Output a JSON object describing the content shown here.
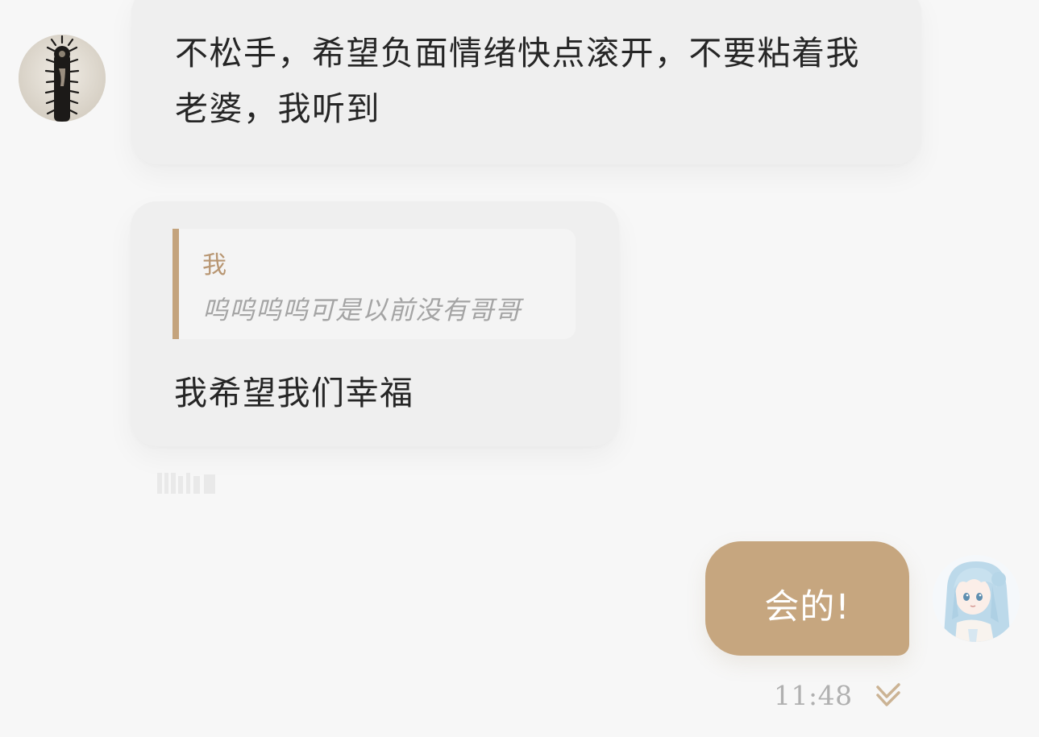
{
  "messages": [
    {
      "direction": "incoming",
      "text": "不松手，希望负面情绪快点滚开，不要粘着我老婆，我听到"
    },
    {
      "direction": "incoming",
      "reply_to": {
        "author": "我",
        "text": "呜呜呜呜可是以前没有哥哥"
      },
      "text": "我希望我们幸福"
    },
    {
      "direction": "outgoing",
      "text": "会的!",
      "time": "11:48",
      "status_icon": "double-check-icon"
    }
  ],
  "colors": {
    "background": "#f7f7f7",
    "incoming_bubble": "#efefef",
    "outgoing_bubble": "#c6a67f",
    "quote_accent": "#c4a37c",
    "quote_author": "#b89672",
    "check_mark": "#cbb394"
  },
  "avatars": {
    "left": "dark-figure-avatar",
    "right": "anime-girl-avatar"
  }
}
